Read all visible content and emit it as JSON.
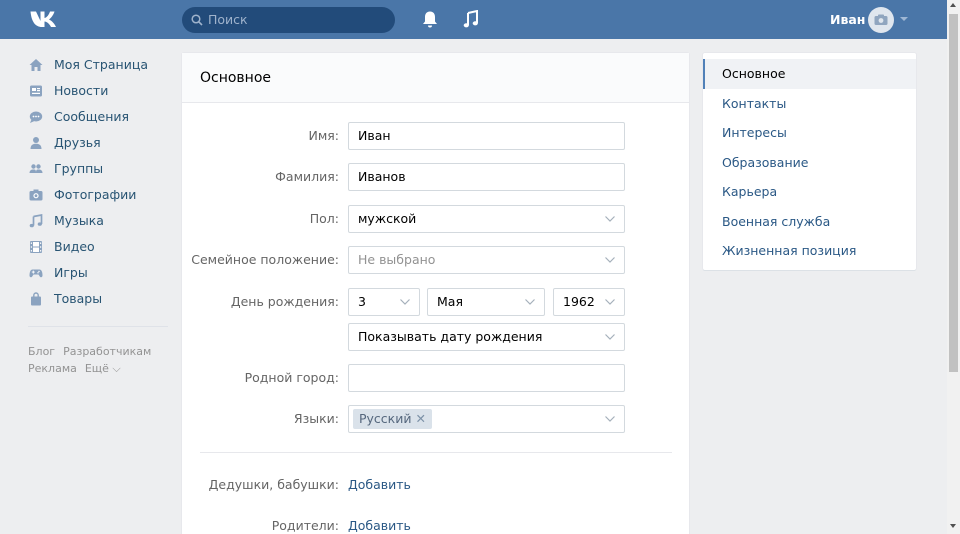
{
  "header": {
    "logo_icon": "vk-logo-icon",
    "search_placeholder": "Поиск",
    "user_name": "Иван",
    "accent": "#4a76a8"
  },
  "nav": {
    "items": [
      {
        "label": "Моя Страница",
        "icon": "home-icon"
      },
      {
        "label": "Новости",
        "icon": "news-icon"
      },
      {
        "label": "Сообщения",
        "icon": "messages-icon"
      },
      {
        "label": "Друзья",
        "icon": "friend-icon"
      },
      {
        "label": "Группы",
        "icon": "groups-icon"
      },
      {
        "label": "Фотографии",
        "icon": "camera-icon"
      },
      {
        "label": "Музыка",
        "icon": "music-icon"
      },
      {
        "label": "Видео",
        "icon": "video-icon"
      },
      {
        "label": "Игры",
        "icon": "gamepad-icon"
      },
      {
        "label": "Товары",
        "icon": "shopping-bag-icon"
      }
    ],
    "footer": {
      "blog": "Блог",
      "developers": "Разработчикам",
      "ads": "Реклама",
      "more": "Ещё ⌵"
    }
  },
  "form": {
    "title": "Основное",
    "first_name_label": "Имя:",
    "first_name_value": "Иван",
    "last_name_label": "Фамилия:",
    "last_name_value": "Иванов",
    "gender_label": "Пол:",
    "gender_value": "мужской",
    "marital_label": "Семейное положение:",
    "marital_placeholder": "Не выбрано",
    "birthday_label": "День рождения:",
    "birth_day": "3",
    "birth_month": "Мая",
    "birth_year": "1962",
    "birthday_visibility": "Показывать дату рождения",
    "hometown_label": "Родной город:",
    "hometown_value": "",
    "languages_label": "Языки:",
    "language_tag": "Русский",
    "grandparents_label": "Дедушки, бабушки:",
    "parents_label": "Родители:",
    "add_link": "Добавить"
  },
  "menu": {
    "items": [
      {
        "label": "Основное",
        "active": true
      },
      {
        "label": "Контакты",
        "active": false
      },
      {
        "label": "Интересы",
        "active": false
      },
      {
        "label": "Образование",
        "active": false
      },
      {
        "label": "Карьера",
        "active": false
      },
      {
        "label": "Военная служба",
        "active": false
      },
      {
        "label": "Жизненная позиция",
        "active": false
      }
    ]
  }
}
